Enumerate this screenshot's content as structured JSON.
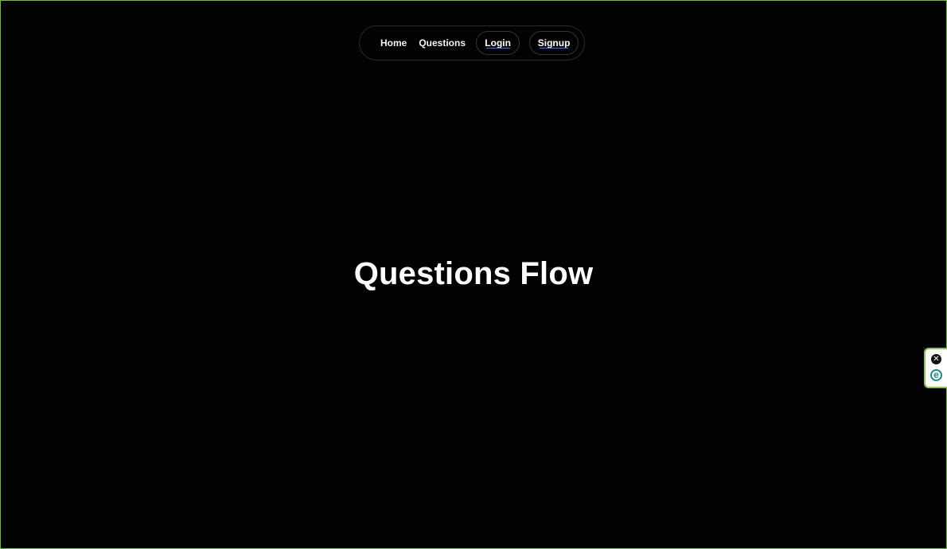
{
  "nav": {
    "home": "Home",
    "questions": "Questions",
    "login": "Login",
    "signup": "Signup"
  },
  "hero": {
    "title": "Questions Flow"
  },
  "extension_widget": {
    "close_icon": "close-icon",
    "logo_icon": "e-logo-icon",
    "close_glyph": "✕",
    "logo_glyph": "e"
  },
  "colors": {
    "background": "#000000",
    "frame_border": "#6fbf2a",
    "accent_underline": "#4a6cf7",
    "widget_border": "#8dc63f",
    "logo_teal": "#1a8a8a"
  }
}
